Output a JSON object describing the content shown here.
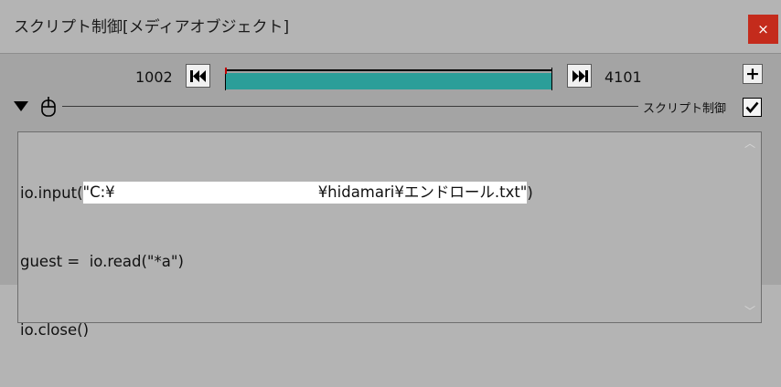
{
  "window": {
    "title": "スクリプト制御[メディアオブジェクト]",
    "close_icon": "×"
  },
  "timeline": {
    "start_frame": "1002",
    "end_frame": "4101",
    "colors": {
      "fill": "#2b9e99",
      "start_marker": "#c00000"
    }
  },
  "section": {
    "label": "スクリプト制御",
    "enabled": true
  },
  "editor": {
    "lines": [
      {
        "prefix": "io.input(",
        "str_start": "\"C:¥",
        "str_end": "¥hidamari¥エンドロール.txt\"",
        "suffix": ")"
      },
      {
        "text": "guest =  io.read(\"*a\")"
      },
      {
        "text": "io.close()"
      }
    ]
  }
}
